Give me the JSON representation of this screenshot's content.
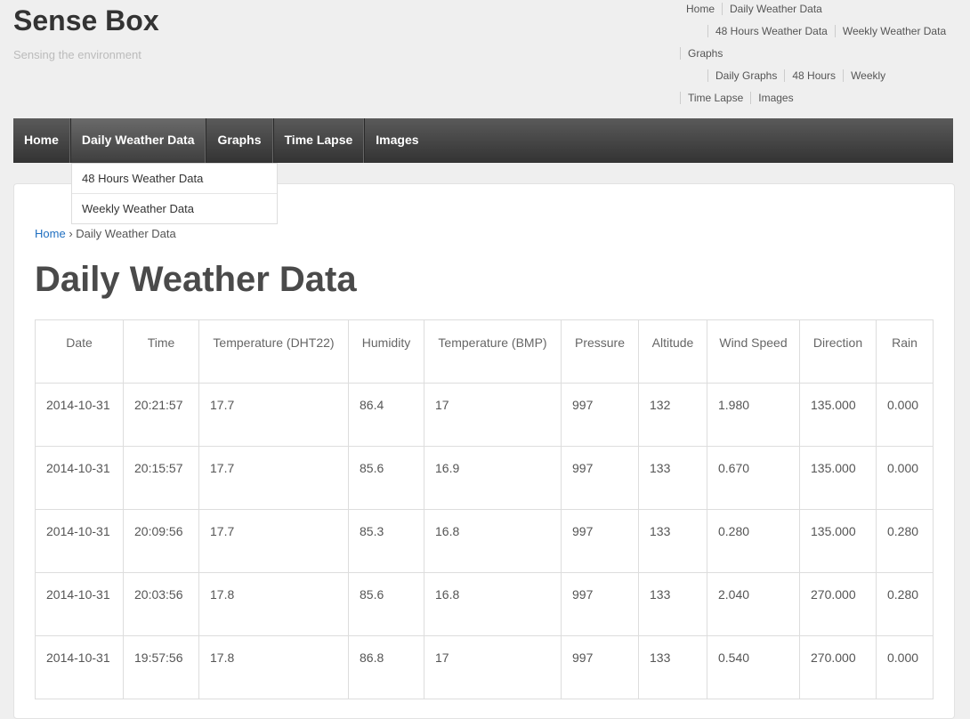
{
  "site": {
    "title": "Sense Box",
    "tagline": "Sensing the environment"
  },
  "top_nav": {
    "row1": [
      "Home",
      "Daily Weather Data"
    ],
    "row2": [
      "48 Hours Weather Data",
      "Weekly Weather Data"
    ],
    "row3": [
      "Graphs"
    ],
    "row4": [
      "Daily Graphs",
      "48 Hours",
      "Weekly"
    ],
    "row5": [
      "Time Lapse",
      "Images"
    ]
  },
  "main_nav": {
    "items": [
      "Home",
      "Daily Weather Data",
      "Graphs",
      "Time Lapse",
      "Images"
    ],
    "active": "Daily Weather Data"
  },
  "dropdown": {
    "items": [
      "48 Hours Weather Data",
      "Weekly Weather Data"
    ]
  },
  "breadcrumb": {
    "home": "Home",
    "separator": "›",
    "current": "Daily Weather Data"
  },
  "page": {
    "title": "Daily Weather Data"
  },
  "table": {
    "headers": [
      "Date",
      "Time",
      "Temperature (DHT22)",
      "Humidity",
      "Temperature (BMP)",
      "Pressure",
      "Altitude",
      "Wind Speed",
      "Direction",
      "Rain"
    ],
    "rows": [
      [
        "2014-10-31",
        "20:21:57",
        "17.7",
        "86.4",
        "17",
        "997",
        "132",
        "1.980",
        "135.000",
        "0.000"
      ],
      [
        "2014-10-31",
        "20:15:57",
        "17.7",
        "85.6",
        "16.9",
        "997",
        "133",
        "0.670",
        "135.000",
        "0.000"
      ],
      [
        "2014-10-31",
        "20:09:56",
        "17.7",
        "85.3",
        "16.8",
        "997",
        "133",
        "0.280",
        "135.000",
        "0.280"
      ],
      [
        "2014-10-31",
        "20:03:56",
        "17.8",
        "85.6",
        "16.8",
        "997",
        "133",
        "2.040",
        "270.000",
        "0.280"
      ],
      [
        "2014-10-31",
        "19:57:56",
        "17.8",
        "86.8",
        "17",
        "997",
        "133",
        "0.540",
        "270.000",
        "0.000"
      ]
    ]
  },
  "colors": {
    "background": "#efefef",
    "nav_dark": "#333333",
    "link": "#1e6ec0"
  }
}
